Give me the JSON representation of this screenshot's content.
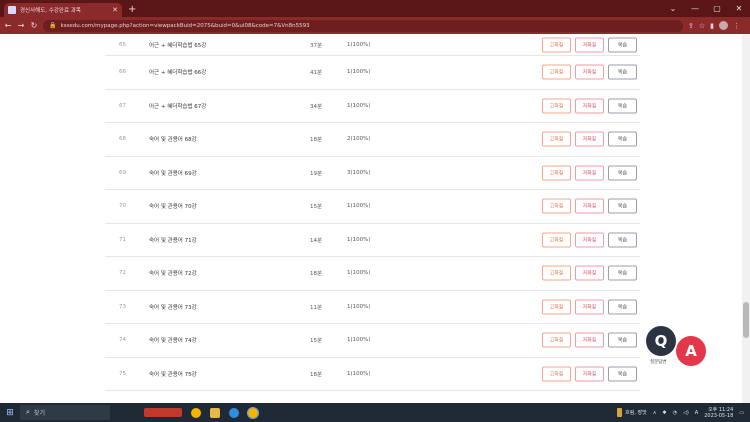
{
  "browser": {
    "tab_title": "경신사해도, 수강완료 과목",
    "url": "kssedu.com/mypage.php?action=viewpackBuid=2075&buid=0&ui08&code=7&Vn8n5593",
    "new_tab_icon": "plus-icon",
    "window_controls": [
      "minimize-icon",
      "maximize-icon",
      "close-icon"
    ]
  },
  "lectures": [
    {
      "num": "65",
      "title": "어근 + 혜더학습법 65강",
      "duration": "37분",
      "count": "1(100%)"
    },
    {
      "num": "66",
      "title": "어근 + 혜더학습법 66강",
      "duration": "41분",
      "count": "1(100%)"
    },
    {
      "num": "67",
      "title": "어근 + 혜더학습법 67강",
      "duration": "34분",
      "count": "1(100%)"
    },
    {
      "num": "68",
      "title": "숙어 및 관용어 68강",
      "duration": "18분",
      "count": "2(100%)"
    },
    {
      "num": "69",
      "title": "숙어 및 관용어 69강",
      "duration": "19분",
      "count": "3(100%)"
    },
    {
      "num": "70",
      "title": "숙어 및 관용어 70강",
      "duration": "15분",
      "count": "1(100%)"
    },
    {
      "num": "71",
      "title": "숙어 및 관용어 71강",
      "duration": "14분",
      "count": "1(100%)"
    },
    {
      "num": "72",
      "title": "숙어 및 관용어 72강",
      "duration": "18분",
      "count": "1(100%)"
    },
    {
      "num": "73",
      "title": "숙어 및 관용어 73강",
      "duration": "11분",
      "count": "1(100%)"
    },
    {
      "num": "74",
      "title": "숙어 및 관용어 74강",
      "duration": "15분",
      "count": "1(100%)"
    },
    {
      "num": "75",
      "title": "숙어 및 관용어 75강",
      "duration": "18분",
      "count": "1(100%)"
    }
  ],
  "buttons": {
    "goto": "고화질",
    "review": "저화질",
    "replay": "복습"
  },
  "qa_badge": {
    "q": "Q",
    "a": "A",
    "caption": "질문답변"
  },
  "taskbar": {
    "search_placeholder": "찾기",
    "weather": "흐림, 장맛",
    "time": "오후 11:24",
    "date": "2023-05-18"
  },
  "colors": {
    "titlebar": "#5a1516",
    "toolbar": "#8a2a2b",
    "goto_btn": "#e4764a",
    "review_btn": "#e0566a",
    "qa_q": "#2b3440",
    "qa_a": "#e4384a",
    "taskbar": "#1f2a36"
  }
}
